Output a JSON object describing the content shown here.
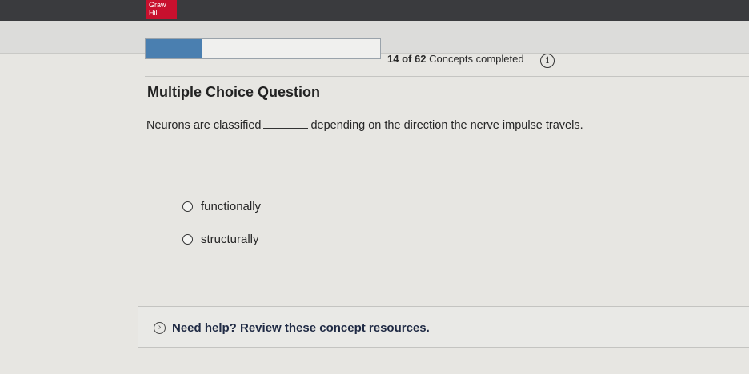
{
  "brand": {
    "logo_line1": "Graw",
    "logo_line2": "Hill",
    "color": "#c8102e"
  },
  "progress": {
    "completed": "14",
    "of_label": "of",
    "total": "62",
    "suffix": "Concepts completed",
    "fraction": 0.24
  },
  "question": {
    "type_label": "Multiple Choice Question",
    "text_before": "Neurons are classified",
    "text_after": "depending on the direction the nerve impulse travels.",
    "options": [
      {
        "label": "functionally"
      },
      {
        "label": "structurally"
      }
    ]
  },
  "help": {
    "label": "Need help? Review these concept resources."
  },
  "icons": {
    "info": "info-icon",
    "help": "chevron-right-circle-icon"
  }
}
